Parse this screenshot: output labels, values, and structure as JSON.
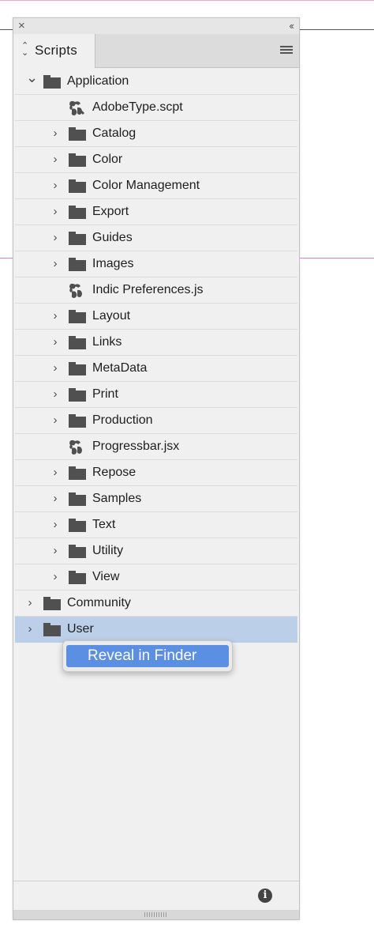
{
  "colors": {
    "guide_top": "#f7a8c6",
    "guide_mid": "#e07be0",
    "guide_dark": "#555555",
    "selection": "#bccfe9",
    "menu_highlight": "#5b8fe3"
  },
  "panel": {
    "close_icon": "×",
    "collapse_icon": "‹‹",
    "tab_label": "Scripts",
    "tab_updown_icon": "⌃⌄"
  },
  "tree": {
    "rows": [
      {
        "label": "Application",
        "kind": "folder",
        "level": 0,
        "expanded": true
      },
      {
        "label": "AdobeType.scpt",
        "kind": "applescript",
        "level": 1
      },
      {
        "label": "Catalog",
        "kind": "folder",
        "level": 1
      },
      {
        "label": "Color",
        "kind": "folder",
        "level": 1
      },
      {
        "label": "Color Management",
        "kind": "folder",
        "level": 1
      },
      {
        "label": "Export",
        "kind": "folder",
        "level": 1
      },
      {
        "label": "Guides",
        "kind": "folder",
        "level": 1
      },
      {
        "label": "Images",
        "kind": "folder",
        "level": 1
      },
      {
        "label": "Indic Preferences.js",
        "kind": "javascript",
        "level": 1
      },
      {
        "label": "Layout",
        "kind": "folder",
        "level": 1
      },
      {
        "label": "Links",
        "kind": "folder",
        "level": 1
      },
      {
        "label": "MetaData",
        "kind": "folder",
        "level": 1
      },
      {
        "label": "Print",
        "kind": "folder",
        "level": 1
      },
      {
        "label": "Production",
        "kind": "folder",
        "level": 1
      },
      {
        "label": "Progressbar.jsx",
        "kind": "javascript",
        "level": 1
      },
      {
        "label": "Repose",
        "kind": "folder",
        "level": 1
      },
      {
        "label": "Samples",
        "kind": "folder",
        "level": 1
      },
      {
        "label": "Text",
        "kind": "folder",
        "level": 1
      },
      {
        "label": "Utility",
        "kind": "folder",
        "level": 1
      },
      {
        "label": "View",
        "kind": "folder",
        "level": 1
      },
      {
        "label": "Community",
        "kind": "folder",
        "level": 0
      },
      {
        "label": "User",
        "kind": "folder",
        "level": 0,
        "selected": true
      }
    ]
  },
  "context_menu": {
    "items": [
      {
        "label": "Reveal in Finder",
        "highlighted": true
      }
    ]
  },
  "footer": {
    "info_icon": "i"
  }
}
